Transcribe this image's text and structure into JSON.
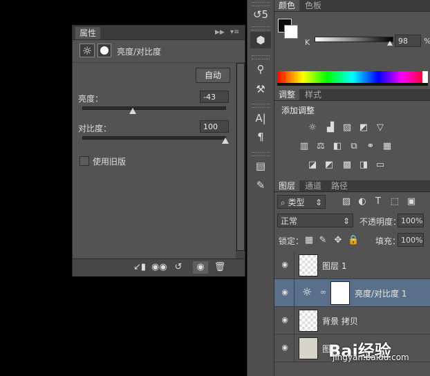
{
  "properties_panel": {
    "tab_label": "属性",
    "collapse_icon": "double-chevron-right-icon",
    "title": "亮度/对比度",
    "auto_button": "自动",
    "brightness": {
      "label": "亮度：",
      "value": "-43"
    },
    "contrast": {
      "label": "对比度：",
      "value": "100"
    },
    "legacy_checkbox": {
      "label": "使用旧版",
      "checked": false
    }
  },
  "color_panel": {
    "tabs": [
      "颜色",
      "色板"
    ],
    "k_label": "K",
    "k_value": "98",
    "k_unit": "%"
  },
  "adjustments_panel": {
    "tabs": [
      "调整",
      "样式"
    ],
    "add_adjustment_label": "添加调整"
  },
  "layers_panel": {
    "tabs": [
      "图层",
      "通道",
      "路径"
    ],
    "filter_kind": "类型",
    "blend_mode": "正常",
    "opacity_label": "不透明度：",
    "opacity_value": "100%",
    "lock_label": "锁定：",
    "fill_label": "填充：",
    "fill_value": "100%",
    "layers": [
      {
        "name": "图层 1",
        "selected": false
      },
      {
        "name": "亮度/对比度 1",
        "selected": true
      },
      {
        "name": "背景 拷贝",
        "selected": false
      },
      {
        "name": "图层",
        "selected": false
      }
    ]
  },
  "watermark": {
    "brand": "Bai经验",
    "url": "jingyan.baidu.com"
  }
}
